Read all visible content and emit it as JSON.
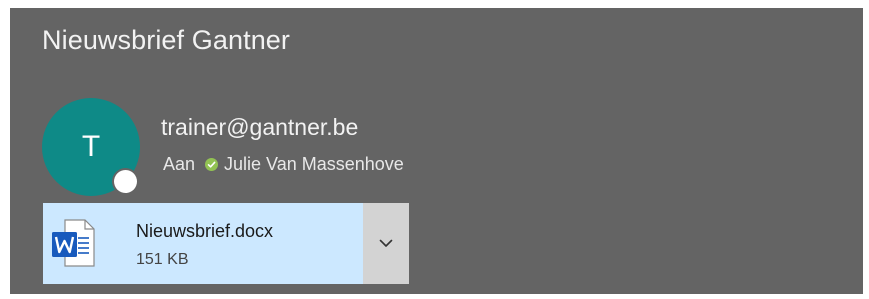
{
  "email": {
    "subject": "Nieuwsbrief Gantner",
    "sender": {
      "initial": "T",
      "address": "trainer@gantner.be",
      "avatar_color": "#0e8a87"
    },
    "recipients": {
      "label": "Aan",
      "names": [
        "Julie Van Massenhove"
      ],
      "verified_color": "#92c353"
    },
    "attachment": {
      "filename": "Nieuwsbrief.docx",
      "size": "151 KB",
      "icon": "word-document-icon",
      "highlight_color": "#cce8ff"
    }
  },
  "colors": {
    "pane_background": "#646464",
    "word_blue": "#185abd"
  }
}
